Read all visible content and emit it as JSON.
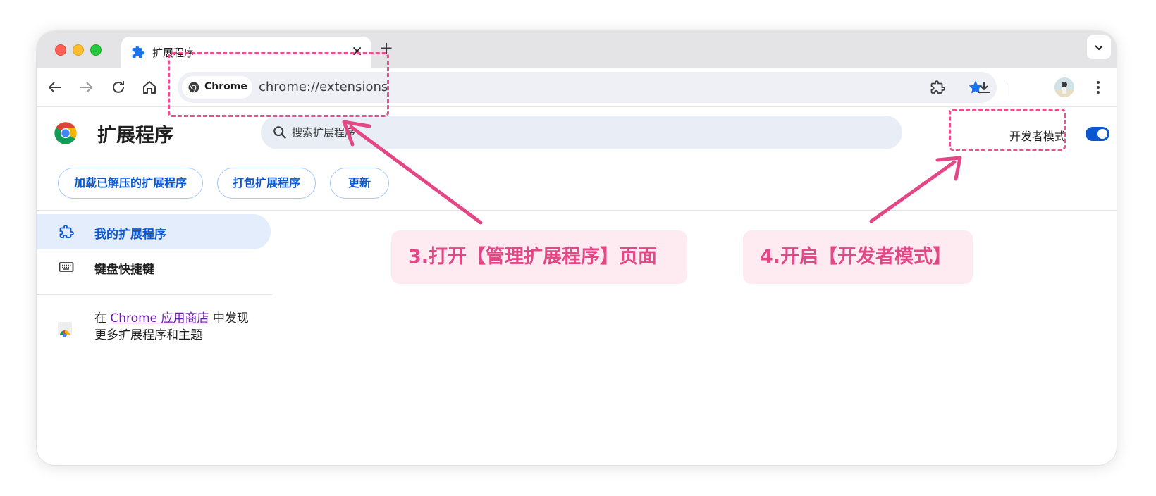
{
  "tab": {
    "title": "扩展程序",
    "close": "×",
    "new_tab": "+"
  },
  "omnibox": {
    "chip_label": "Chrome",
    "url": "chrome://extensions"
  },
  "page": {
    "title": "扩展程序",
    "search_placeholder": "搜索扩展程序",
    "developer_mode_label": "开发者模式",
    "developer_mode_on": true,
    "buttons": {
      "load_unpacked": "加载已解压的扩展程序",
      "pack": "打包扩展程序",
      "update": "更新"
    },
    "sidebar": {
      "items": [
        {
          "label": "我的扩展程序",
          "icon": "puzzle-icon",
          "active": true
        },
        {
          "label": "键盘快捷键",
          "icon": "keyboard-icon",
          "active": false
        }
      ],
      "store_prefix": "在 ",
      "store_link": "Chrome 应用商店",
      "store_suffix": " 中发现",
      "store_line2": "更多扩展程序和主题"
    }
  },
  "annotations": {
    "callout_3": "3.打开【管理扩展程序】页面",
    "callout_4": "4.开启【开发者模式】"
  },
  "colors": {
    "accent": "#0b57d0",
    "annotation": "#e8508f",
    "callout_bg": "#fdebf1"
  }
}
